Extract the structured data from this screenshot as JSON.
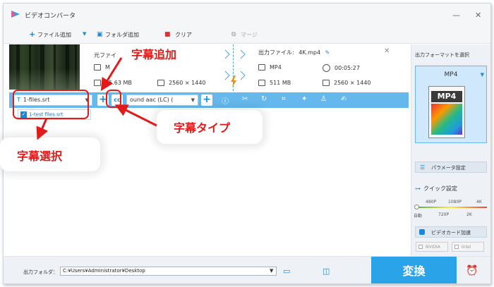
{
  "window": {
    "title": "ビデオコンバータ",
    "minimize_glyph": "—",
    "close_glyph": "✕"
  },
  "toolbar": {
    "add_file": "ファイル追加",
    "add_folder": "フォルダ追加",
    "clear": "クリア",
    "merge": "マージ"
  },
  "source": {
    "label": "元ファイ",
    "format_partial": "M",
    "size": "65.63 MB",
    "resolution": "2560 × 1440"
  },
  "output": {
    "label": "出力ファイル:",
    "filename": "4K.mp4",
    "format": "MP4",
    "duration": "00:05:27",
    "size": "511 MB",
    "resolution": "2560 × 1440"
  },
  "subtitle_toolbar": {
    "subtitle_select_value": "1-files.srt",
    "audio_select_value": "ound aac (LC) (",
    "dropdown_item": "1-test files.srt"
  },
  "right_panel": {
    "title": "出力フォーマットを選択",
    "format_name": "MP4",
    "format_icon_text": "MP4",
    "params_button": "パラメータ設定",
    "quick_label": "クイック設定",
    "quick_top_ticks": [
      "480P",
      "1080P",
      "4K"
    ],
    "quick_bottom_ticks": [
      "自動",
      "720P",
      "2K"
    ],
    "hw_accel": "ビデオカード加速",
    "hw_nvidia": "NVIDIA",
    "hw_intel": "Intel"
  },
  "bottom": {
    "output_folder_label": "出力フォルダ：",
    "output_folder_path": "C:¥Users¥Administrator¥Desktop",
    "convert_button": "変換"
  },
  "annotations": {
    "add_subtitle": "字幕追加",
    "subtitle_type": "字幕タイプ",
    "subtitle_select": "字幕選択"
  },
  "colors": {
    "accent": "#2aa3e8",
    "subtoolbar": "#65b8ec",
    "annotation": "#e21a1a"
  }
}
